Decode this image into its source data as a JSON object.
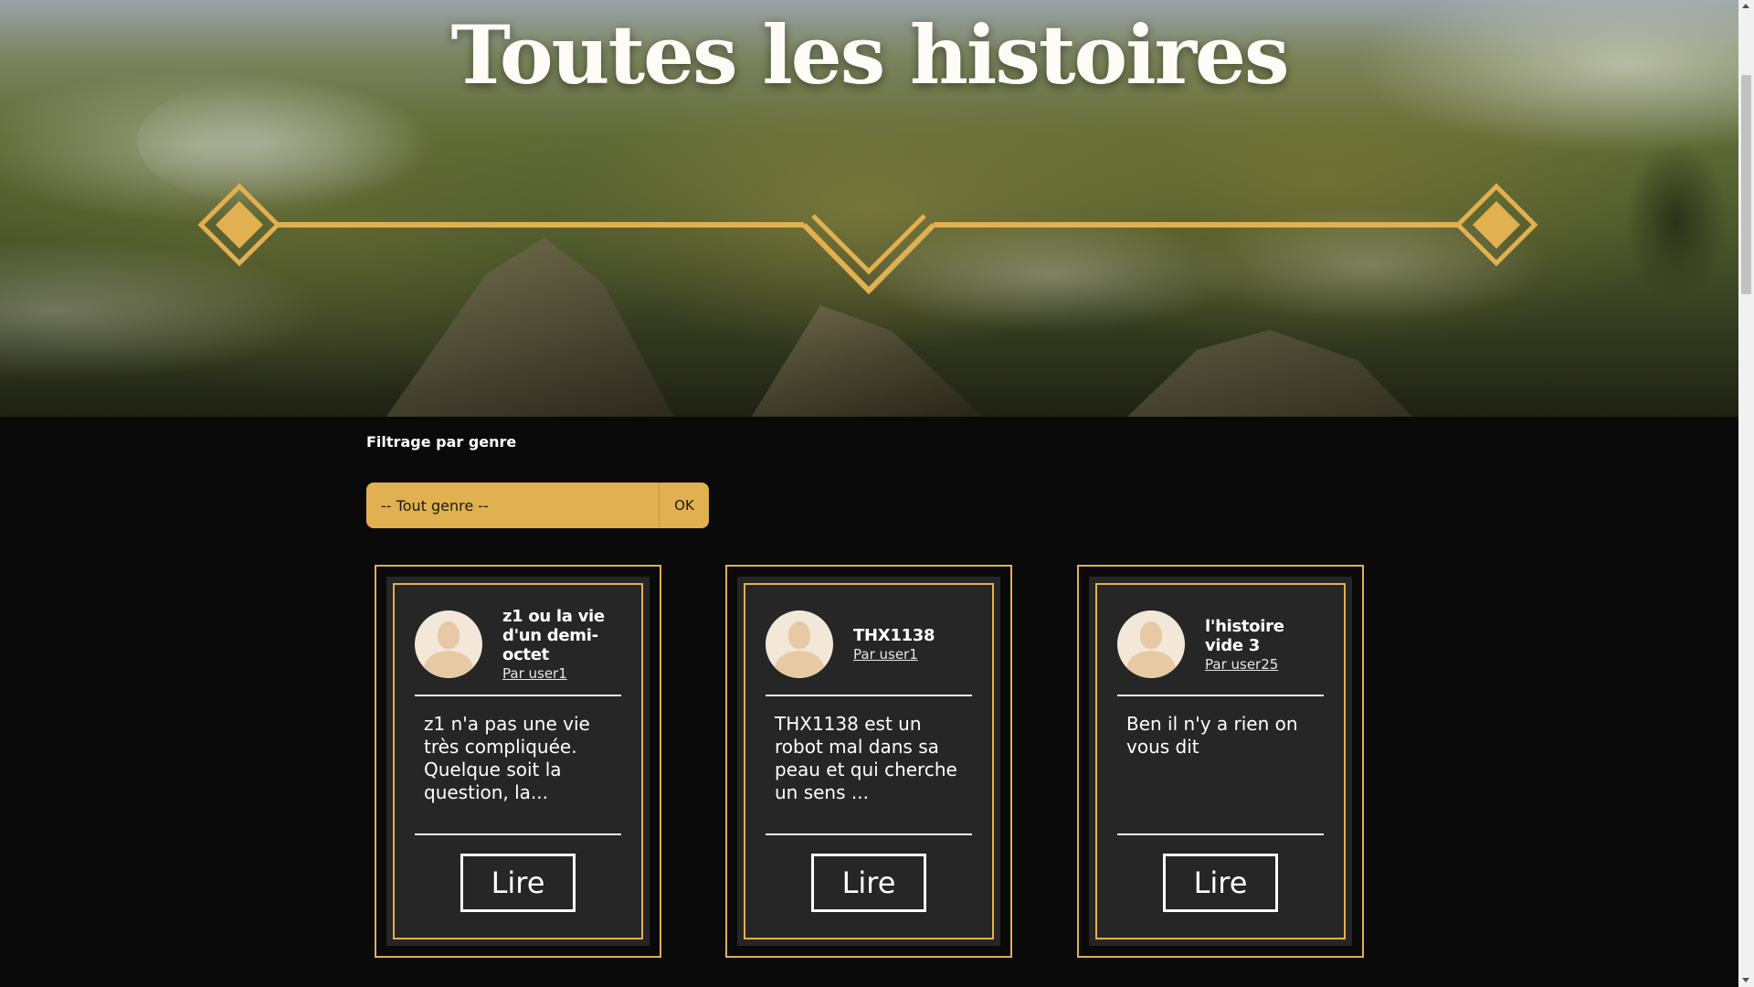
{
  "hero": {
    "title": "Toutes les histoires"
  },
  "filter": {
    "label": "Filtrage par genre",
    "selected_genre": "-- Tout genre --",
    "submit_label": "OK"
  },
  "stories": [
    {
      "title": "z1 ou la vie d'un demi-octet",
      "author": "Par user1",
      "description": "z1 n'a pas une vie très compliquée. Quelque soit la question, la...",
      "read_label": "Lire"
    },
    {
      "title": "THX1138",
      "author": "Par user1",
      "description": "THX1138 est un robot mal dans sa peau et qui cherche un sens ...",
      "read_label": "Lire"
    },
    {
      "title": "l'histoire vide 3",
      "author": "Par user25",
      "description": "Ben il n'y a rien on vous dit",
      "read_label": "Lire"
    }
  ],
  "theme": {
    "accent": "#e1b050",
    "background": "#0a0a0a",
    "card_background": "#262626"
  }
}
